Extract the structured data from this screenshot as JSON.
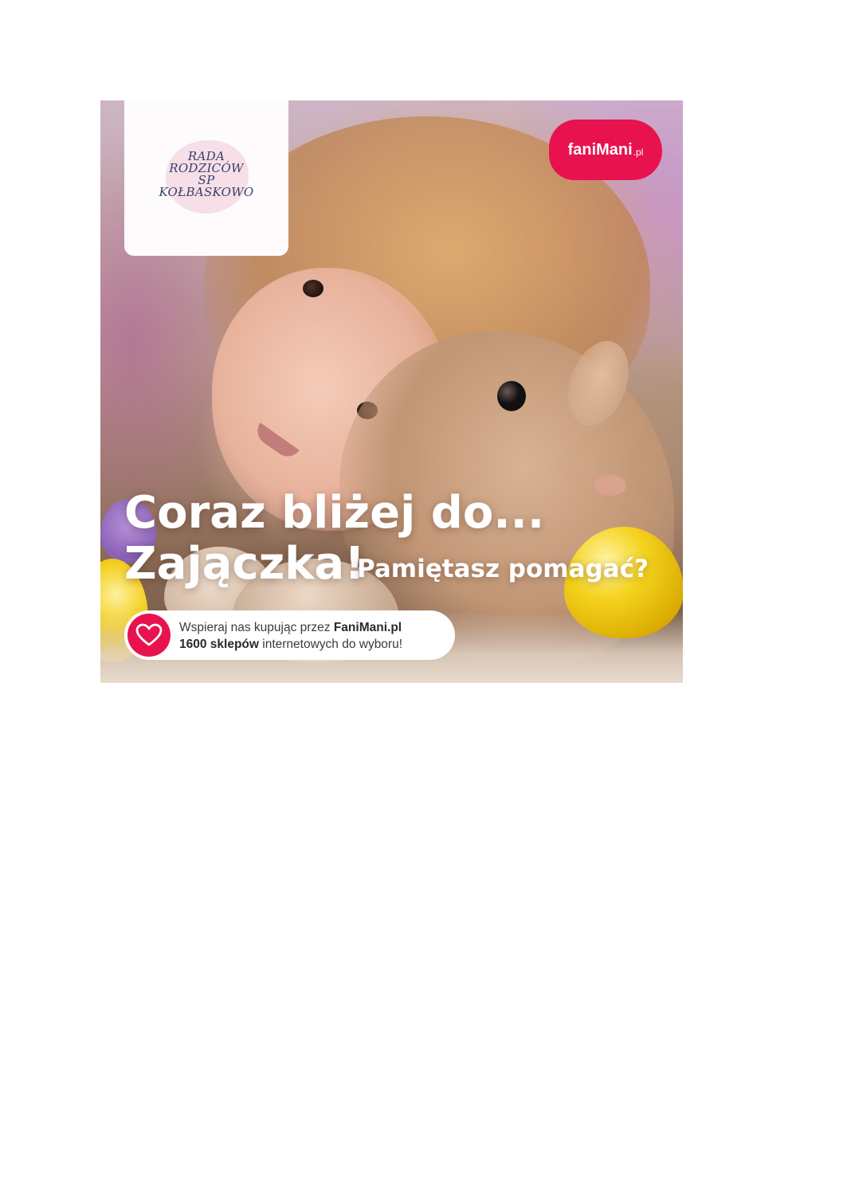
{
  "logo": {
    "lines": [
      "RADA",
      "RODZICÓW",
      "SP",
      "KOŁBASKOWO"
    ]
  },
  "brand": {
    "name": "faniMani",
    "tld": ".pl",
    "color": "#e8124f"
  },
  "headline": {
    "line1": "Coraz bliżej do...",
    "line2": "Zajączka!",
    "line3": "Pamiętasz pomagać?"
  },
  "support": {
    "icon": "heart-icon",
    "line1_prefix": "Wspieraj nas kupując przez ",
    "line1_bold": "FaniMani.pl",
    "line2_bold": "1600 sklepów",
    "line2_suffix": " internetowych do wyboru!"
  },
  "colors": {
    "accent": "#e8124f",
    "logo_text": "#3a3f6b",
    "page_background": "#ffffff"
  }
}
